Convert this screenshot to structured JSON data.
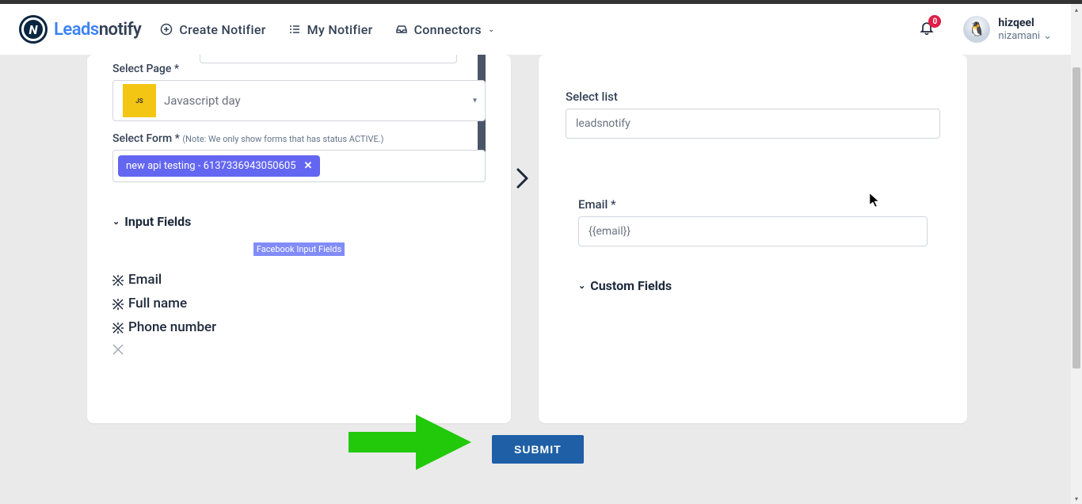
{
  "header": {
    "brand_a": "Leads",
    "brand_b": "notify",
    "nav": {
      "create": "Create Notifier",
      "my": "My Notifier",
      "connectors": "Connectors"
    },
    "notification_count": "0",
    "user": {
      "name": "hizqeel",
      "sub": "nizamani"
    }
  },
  "left": {
    "select_page_label": "Select Page *",
    "page_value": "Javascript day",
    "select_form_label": "Select Form *",
    "form_note": "(Note: We only show forms that has status ACTIVE.)",
    "form_chip": "new api testing - 6137336943050605",
    "input_fields_hd": "Input Fields",
    "pill": "Facebook Input Fields",
    "fields": [
      "Email",
      "Full name",
      "Phone number"
    ]
  },
  "right": {
    "select_list_label": "Select list",
    "list_value": "leadsnotify",
    "email_label": "Email *",
    "email_value": "{{email}}",
    "custom_fields_hd": "Custom Fields"
  },
  "submit_label": "SUBMIT"
}
